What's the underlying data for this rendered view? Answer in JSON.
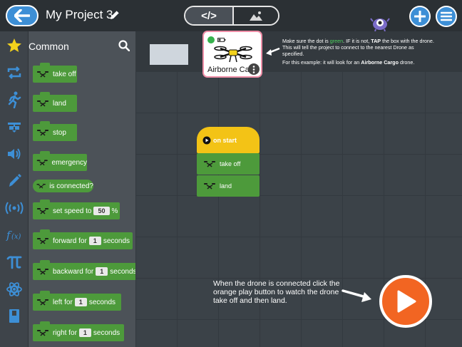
{
  "header": {
    "back_icon": "arrow-left-icon",
    "project_title": "My Project 3",
    "edit_icon": "pencil-icon",
    "mode_code_icon": "code-brackets-icon",
    "mode_code_label": "</>",
    "mode_stage_icon": "mountain-image-icon",
    "bug_icon": "bug-monster-icon",
    "add_icon": "plus-icon",
    "menu_icon": "hamburger-menu-icon"
  },
  "categories": [
    {
      "name": "Common",
      "icon": "star-icon"
    },
    {
      "name": "Control",
      "icon": "loop-arrows-icon"
    },
    {
      "name": "Motion",
      "icon": "running-person-icon"
    },
    {
      "name": "Looks",
      "icon": "glasses-icon"
    },
    {
      "name": "Sound",
      "icon": "speaker-icon"
    },
    {
      "name": "Pen",
      "icon": "pen-icon"
    },
    {
      "name": "Signals",
      "icon": "broadcast-icon"
    },
    {
      "name": "Functions",
      "icon": "function-icon"
    },
    {
      "name": "Math",
      "icon": "pi-icon"
    },
    {
      "name": "Science",
      "icon": "atom-icon"
    },
    {
      "name": "Notes",
      "icon": "book-icon"
    }
  ],
  "palette": {
    "title": "Common",
    "search_icon": "search-icon",
    "blocks": [
      {
        "label": "take off"
      },
      {
        "label": "land"
      },
      {
        "label": "stop"
      },
      {
        "label": "emergency"
      },
      {
        "label": "is connected?"
      },
      {
        "label": "set speed to",
        "value": "50",
        "suffix": "%"
      },
      {
        "label": "forward for",
        "value": "1",
        "suffix": "seconds"
      },
      {
        "label": "backward for",
        "value": "1",
        "suffix": "seconds"
      },
      {
        "label": "left for",
        "value": "1",
        "suffix": "seconds"
      },
      {
        "label": "right for",
        "value": "1",
        "suffix": "seconds"
      }
    ]
  },
  "device": {
    "name": "Airborne Cargo",
    "status_color": "#37b24d",
    "menu_icon": "more-vertical-icon"
  },
  "tip": {
    "p1_before": "Make sure the dot is ",
    "p1_green": "green",
    "p1_mid": ". IF it is not, ",
    "p1_tap": "TAP",
    "p1_after": " the box with the drone. This will tell the project to connect to the nearest Drone as specified.",
    "p2_before": "For this example: it will look for an ",
    "p2_bold": "Airborne Cargo",
    "p2_after": " drone."
  },
  "script": {
    "hat_label": "on start",
    "blocks": [
      {
        "label": "take off"
      },
      {
        "label": "land"
      }
    ]
  },
  "instructions": "When the drone is connected click the orange play button to watch the drone take off and then land.",
  "colors": {
    "accent_blue": "#3d8fd6",
    "block_green": "#4d9a3b",
    "hat_yellow": "#f3c316",
    "play_orange": "#f26522"
  }
}
